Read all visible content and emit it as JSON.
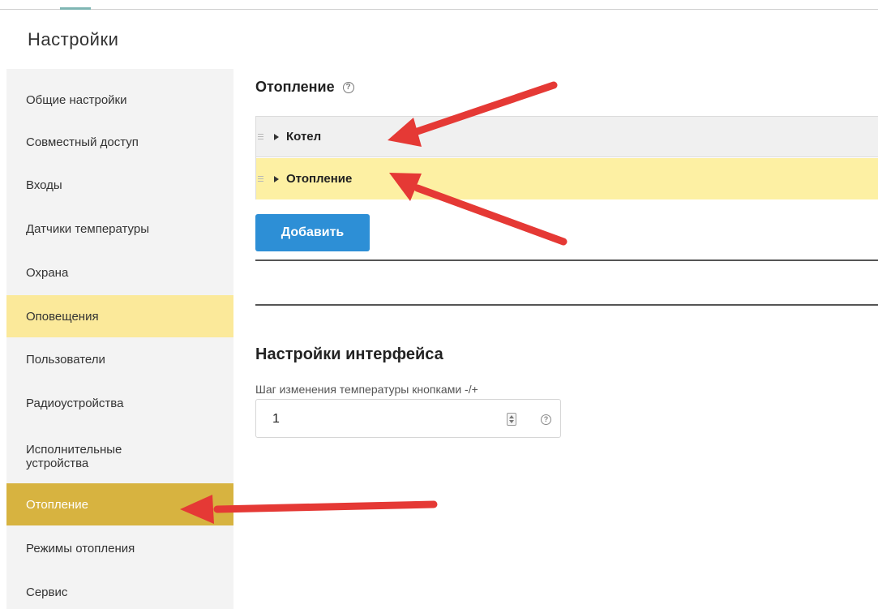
{
  "header": {
    "title": "Настройки"
  },
  "sidebar": {
    "items": [
      {
        "label": "Общие настройки"
      },
      {
        "label": "Совместный доступ"
      },
      {
        "label": "Входы"
      },
      {
        "label": "Датчики температуры"
      },
      {
        "label": "Охрана"
      },
      {
        "label": "Оповещения"
      },
      {
        "label": "Пользователи"
      },
      {
        "label": "Радиоустройства"
      },
      {
        "label": "Исполнительные устройства"
      },
      {
        "label": "Отопление"
      },
      {
        "label": "Режимы отопления"
      },
      {
        "label": "Сервис"
      }
    ],
    "active_item": "Отопление",
    "highlighted_item": "Оповещения"
  },
  "heating": {
    "title": "Отопление",
    "help_symbol": "?",
    "rows": [
      {
        "label": "Котел"
      },
      {
        "label": "Отопление"
      }
    ],
    "add_button_label": "Добавить"
  },
  "interface_settings": {
    "title": "Настройки интерфейса",
    "temp_step": {
      "label": "Шаг изменения температуры кнопками -/+",
      "value": "1",
      "help_symbol": "?"
    }
  },
  "colors": {
    "accent_blue": "#2d8fd6",
    "active_item": "#d7b340",
    "highlight_yellow": "#fbe99a",
    "annotation_red": "#e53935"
  },
  "icons": {
    "help": "help-circle-icon",
    "expand": "caret-right-icon",
    "drag": "drag-handle-icon",
    "spinner": "number-spinner-icon",
    "annotation": "red-arrow-icon"
  }
}
